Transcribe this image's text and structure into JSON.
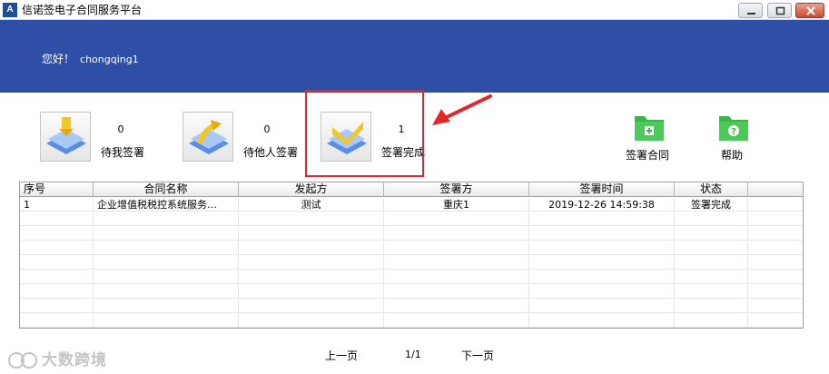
{
  "window": {
    "logo": "A",
    "title": "信诺签电子合同服务平台"
  },
  "header": {
    "greeting": "您好！",
    "username": "chongqing1"
  },
  "tiles": [
    {
      "count": "0",
      "label": "待我签署"
    },
    {
      "count": "0",
      "label": "待他人签署"
    },
    {
      "count": "1",
      "label": "签署完成"
    }
  ],
  "actions": {
    "sign_contract": "签署合同",
    "help": "帮助"
  },
  "table": {
    "columns": [
      "序号",
      "合同名称",
      "发起方",
      "签署方",
      "签署时间",
      "状态"
    ],
    "rows": [
      [
        "1",
        "企业增值税税控系统服务…",
        "测试",
        "重庆1",
        "2019-12-26 14:59:38",
        "签署完成"
      ]
    ]
  },
  "pager": {
    "prev": "上一页",
    "page": "1/1",
    "next": "下一页"
  },
  "watermark": "大数跨境",
  "colors": {
    "header": "#2f4fa6",
    "highlight": "#e0282c",
    "action_green": "#3db54a"
  }
}
